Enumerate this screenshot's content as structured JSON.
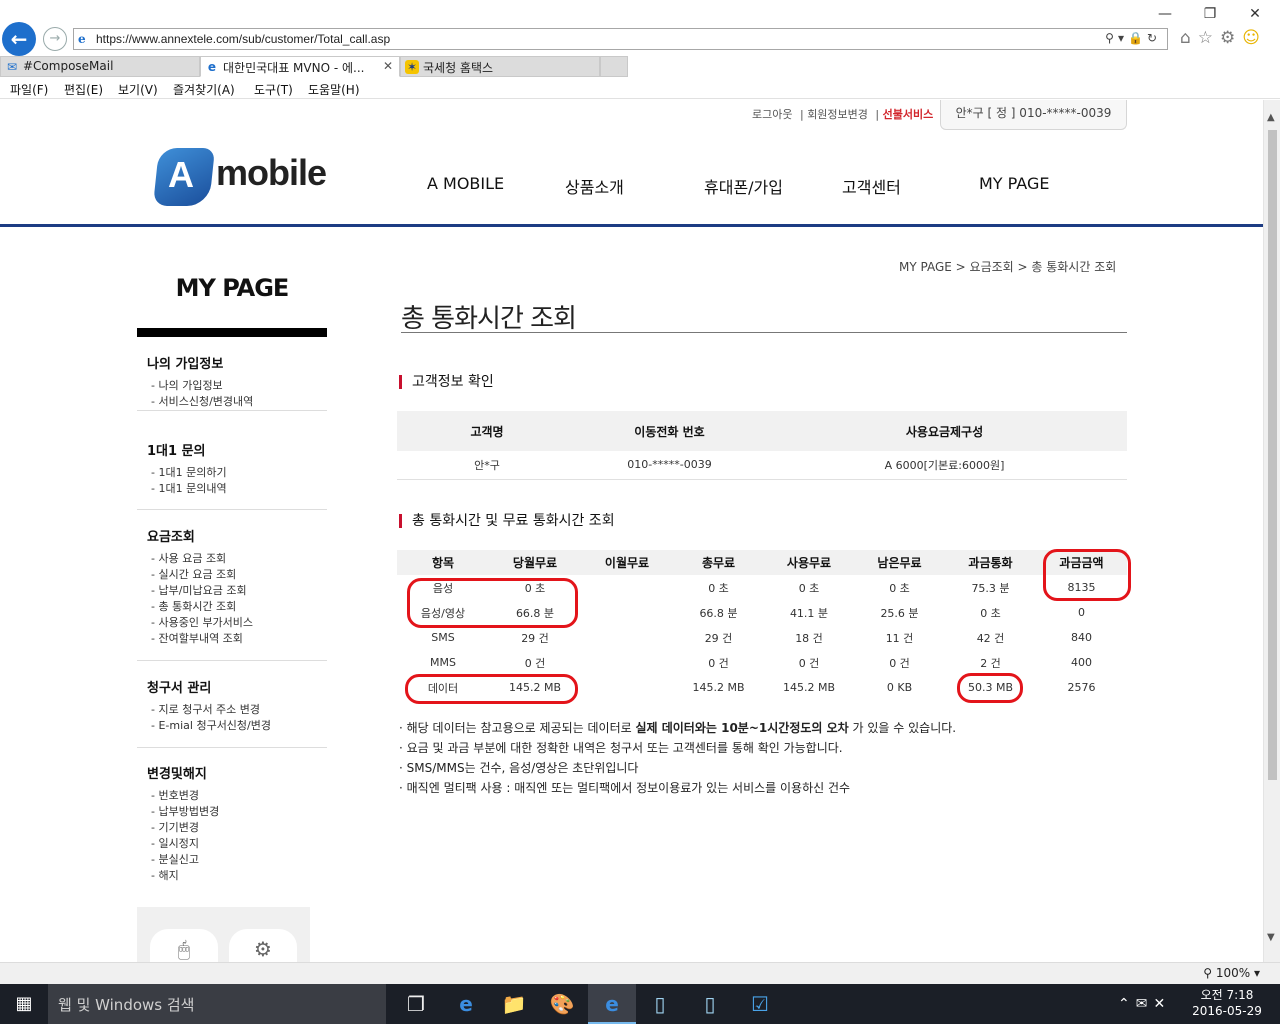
{
  "browser": {
    "url": "https://www.annextele.com/sub/customer/Total_call.asp",
    "tabs": [
      {
        "label": "#ComposeMail",
        "icon": "mail-icon",
        "active": false
      },
      {
        "label": "대한민국대표 MVNO - 에...",
        "icon": "ie-icon",
        "active": true
      },
      {
        "label": "국세청 홈택스",
        "icon": "hometax-icon",
        "active": false
      }
    ],
    "menu": [
      "파일(F)",
      "편집(E)",
      "보기(V)",
      "즐겨찾기(A)",
      "도구(T)",
      "도움말(H)"
    ],
    "zoom": "100%"
  },
  "site": {
    "util_links": [
      "로그아웃",
      "회원정보변경",
      "선불서비스"
    ],
    "user_info": "안*구 [ 정 ] 010-*****-0039",
    "logo_text": "mobile",
    "logo_letter": "A",
    "gnb": [
      "A MOBILE",
      "상품소개",
      "휴대폰/가입",
      "고객센터",
      "MY PAGE"
    ]
  },
  "lnb": {
    "title": "MY PAGE",
    "groups": [
      {
        "title": "나의 가입정보",
        "items": [
          "- 나의 가입정보",
          "- 서비스신청/변경내역"
        ]
      },
      {
        "title": "1대1 문의",
        "items": [
          "- 1대1 문의하기",
          "- 1대1 문의내역"
        ]
      },
      {
        "title": "요금조회",
        "items": [
          "- 사용 요금 조회",
          "- 실시간 요금 조회",
          "- 납부/미납요금 조회",
          "- 총 통화시간 조회",
          "- 사용중인 부가서비스",
          "- 잔여할부내역 조회"
        ]
      },
      {
        "title": "청구서 관리",
        "items": [
          "- 지로 청구서 주소 변경",
          "- E-mial 청구서신청/변경"
        ]
      },
      {
        "title": "변경및해지",
        "items": [
          "- 번호변경",
          "- 납부방법변경",
          "- 기기변경",
          "- 일시정지",
          "- 분실신고",
          "- 해지"
        ]
      }
    ]
  },
  "content": {
    "breadcrumb": "MY PAGE > 요금조회 > 총 통화시간 조회",
    "title": "총 통화시간 조회",
    "section1": "고객정보 확인",
    "info_headers": [
      "고객명",
      "이동전화 번호",
      "사용요금제구성"
    ],
    "info_row": [
      "안*구",
      "010-*****-0039",
      "A 6000[기본료:6000원]"
    ],
    "section2": "총 통화시간 및 무료 통화시간 조회",
    "call_headers": [
      "항목",
      "당월무료",
      "이월무료",
      "총무료",
      "사용무료",
      "남은무료",
      "과금통화",
      "과금금액"
    ],
    "call_rows": [
      [
        "음성",
        "0 초",
        "",
        "0 초",
        "0 초",
        "0 초",
        "75.3 분",
        "8135"
      ],
      [
        "음성/영상",
        "66.8 분",
        "",
        "66.8 분",
        "41.1 분",
        "25.6 분",
        "0 초",
        "0"
      ],
      [
        "SMS",
        "29 건",
        "",
        "29 건",
        "18 건",
        "11 건",
        "42 건",
        "840"
      ],
      [
        "MMS",
        "0 건",
        "",
        "0 건",
        "0 건",
        "0 건",
        "2 건",
        "400"
      ],
      [
        "데이터",
        "145.2 MB",
        "",
        "145.2 MB",
        "145.2 MB",
        "0 KB",
        "50.3 MB",
        "2576"
      ]
    ],
    "notes": [
      {
        "pre": "· 해당 데이터는 참고용으로 제공되는 데이터로 ",
        "bold": "실제 데이터와는 10분~1시간정도의 오차",
        "post": " 가 있을 수 있습니다."
      },
      {
        "pre": "· 요금 및 과금 부분에 대한 정확한 내역은 청구서 또는 고객센터를 통해 확인 가능합니다.",
        "bold": "",
        "post": ""
      },
      {
        "pre": "· SMS/MMS는 건수, 음성/영상은 초단위입니다",
        "bold": "",
        "post": ""
      },
      {
        "pre": "· 매직엔 멀티팩 사용 : 매직엔 또는 멀티팩에서 정보이용료가 있는 서비스를 이용하신 건수",
        "bold": "",
        "post": ""
      }
    ]
  },
  "taskbar": {
    "search_placeholder": "웹 및 Windows 검색",
    "time": "오전 7:18",
    "date": "2016-05-29"
  },
  "colors": {
    "accent": "#1d3c83",
    "highlight": "#e3141a",
    "section_mark": "#c8102e"
  }
}
